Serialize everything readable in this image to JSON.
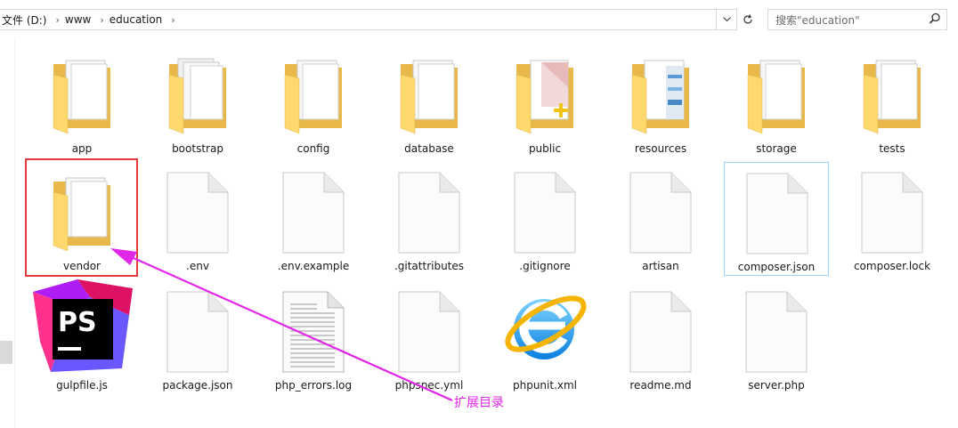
{
  "address_bar": {
    "breadcrumbs": [
      "文件 (D:)",
      "www",
      "education"
    ]
  },
  "search": {
    "placeholder": "搜索\"education\""
  },
  "files": [
    {
      "name": "app",
      "type": "folder"
    },
    {
      "name": "bootstrap",
      "type": "folder"
    },
    {
      "name": "config",
      "type": "folder"
    },
    {
      "name": "database",
      "type": "folder"
    },
    {
      "name": "public",
      "type": "folder"
    },
    {
      "name": "resources",
      "type": "folder"
    },
    {
      "name": "storage",
      "type": "folder"
    },
    {
      "name": "tests",
      "type": "folder"
    },
    {
      "name": "vendor",
      "type": "folder"
    },
    {
      "name": ".env",
      "type": "file"
    },
    {
      "name": ".env.example",
      "type": "file"
    },
    {
      "name": ".gitattributes",
      "type": "file"
    },
    {
      "name": ".gitignore",
      "type": "file"
    },
    {
      "name": "artisan",
      "type": "file"
    },
    {
      "name": "composer.json",
      "type": "file"
    },
    {
      "name": "composer.lock",
      "type": "file"
    },
    {
      "name": "gulpfile.js",
      "type": "phpstorm"
    },
    {
      "name": "package.json",
      "type": "file"
    },
    {
      "name": "php_errors.log",
      "type": "text"
    },
    {
      "name": "phpspec.yml",
      "type": "file"
    },
    {
      "name": "phpunit.xml",
      "type": "ie"
    },
    {
      "name": "readme.md",
      "type": "file"
    },
    {
      "name": "server.php",
      "type": "file"
    }
  ],
  "annotation": {
    "text": "扩展目录"
  },
  "colors": {
    "highlight_box": "#e63b3b",
    "arrow": "#e026e6",
    "hover_border": "#99d1ff"
  }
}
